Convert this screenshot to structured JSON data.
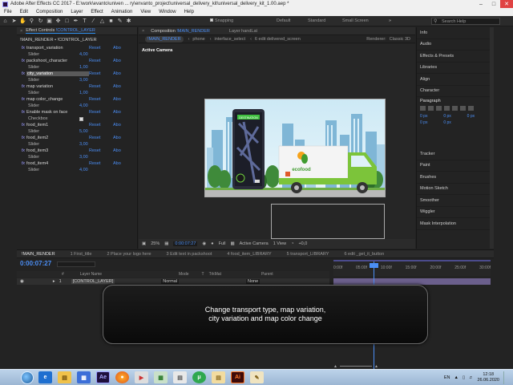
{
  "window": {
    "title": "Adobe After Effects CC 2017 - E:\\work\\evanto\\univen ... ry\\envanto_project\\universal_delivery_kit\\universal_delivery_kit_1.00.aep *"
  },
  "menu": [
    "File",
    "Edit",
    "Composition",
    "Layer",
    "Effect",
    "Animation",
    "View",
    "Window",
    "Help"
  ],
  "toolbar": {
    "snapping": "Snapping",
    "workspaces": [
      "Default",
      "Standard",
      "Small Screen"
    ],
    "search_placeholder": "Search Help"
  },
  "effect_controls": {
    "tab_label": "Effect Controls",
    "tab_layer": "!CONTROL_LAYER",
    "breadcrumb": "!MAIN_RENDER • !CONTROL_LAYER",
    "reset_label": "Reset",
    "about_label": "Abo",
    "effects": [
      {
        "name": "transport_variation",
        "sub": "Slider",
        "value": "4,00"
      },
      {
        "name": "packshoot_character",
        "sub": "Slider",
        "value": "1,00"
      },
      {
        "name": "city_variation",
        "sub": "Slider",
        "value": "3,00"
      },
      {
        "name": "map variation",
        "sub": "Slider",
        "value": "1,00"
      },
      {
        "name": "map color_change",
        "sub": "Slider",
        "value": "4,00"
      },
      {
        "name": "Enable mask on face",
        "sub": "Checkbox",
        "value": ""
      },
      {
        "name": "food_item1",
        "sub": "Slider",
        "value": "5,00"
      },
      {
        "name": "food_item2",
        "sub": "Slider",
        "value": "3,00"
      },
      {
        "name": "food_item3",
        "sub": "Slider",
        "value": "3,00"
      },
      {
        "name": "food_item4",
        "sub": "Slider",
        "value": "4,00"
      }
    ]
  },
  "composition": {
    "tab_label": "Composition",
    "tab_comp": "!MAIN_RENDER",
    "layer_tab": "Layer handLat",
    "crumbs": [
      "!MAIN_RENDER",
      "phone",
      "interface_select",
      "6 edit delivered_screen"
    ],
    "renderer_label": "Renderer:",
    "renderer_value": "Classic 3D",
    "active_camera": "Active Camera",
    "brand": "ecofood",
    "phone_label": "DESTINATION",
    "footer": {
      "zoom": "25%",
      "timecode": "0:00:07:27",
      "resolution": "Full",
      "camera": "Active Camera",
      "views": "1 View",
      "offset": "+0,0"
    }
  },
  "right_panel": {
    "items": [
      "Info",
      "Audio",
      "Effects & Presets",
      "Libraries",
      "Align",
      "Character",
      "Paragraph",
      "Tracker",
      "Paint",
      "Brushes",
      "Motion Sketch",
      "Smoother",
      "Wiggler",
      "Mask Interpolation"
    ],
    "para_values": [
      "0 px",
      "0 px",
      "0 px",
      "0 px",
      "0 px"
    ]
  },
  "timeline": {
    "tabs": [
      "!MAIN_RENDER",
      "1 First_title",
      "2 Place your logo here",
      "3 Edit text in packshoot",
      "4 food_item_LIBRARY",
      "5 transport_LIBRARY",
      "6 edit _get_it_button"
    ],
    "timecode": "0:00:07:27",
    "columns": [
      "#",
      "Layer Name",
      "Mode",
      "T",
      "TrkMat",
      "Parent"
    ],
    "layer": {
      "index": "1",
      "name": "[CONTROL_LAYER]",
      "mode": "Normal",
      "parent": "None"
    },
    "ruler": [
      "0:00f",
      "05:00f",
      "10:00f",
      "15:00f",
      "20:00f",
      "25:00f",
      "30:00f"
    ]
  },
  "overlay": {
    "line1": "Change transport type, map variation,",
    "line2": "city variation and map color change"
  },
  "taskbar": {
    "lang": "EN",
    "time": "12:18",
    "date": "26.06.2020"
  }
}
